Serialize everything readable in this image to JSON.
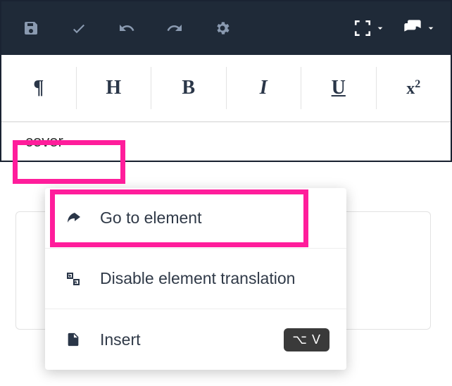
{
  "toolbar": {
    "save": "Save",
    "confirm": "Confirm",
    "undo": "Undo",
    "redo": "Redo",
    "settings": "Settings",
    "fullscreen": "Fullscreen",
    "comments": "Comments"
  },
  "format": {
    "pilcrow": "¶",
    "heading": "H",
    "bold": "B",
    "italic": "I",
    "underline": "U",
    "superscript_base": "x",
    "superscript_sup": "2"
  },
  "breadcrumb": {
    "current": "cover"
  },
  "menu": {
    "goto": "Go to element",
    "disable_translation": "Disable element translation",
    "insert": "Insert",
    "insert_shortcut": "⌥ V"
  }
}
